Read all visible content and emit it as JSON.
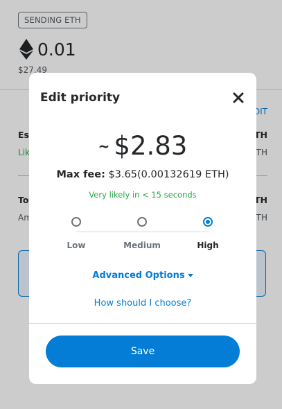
{
  "background": {
    "badge": "SENDING ETH",
    "eth_amount": "0.01",
    "fiat_amount": "$27.49",
    "edit_link": "DIT",
    "rows": [
      {
        "label": "Es",
        "sub": "Lik",
        "right": "TH",
        "right_sub": "TH"
      },
      {
        "label": "To",
        "sub": "Am",
        "right": "TH",
        "right_sub": "TH"
      }
    ]
  },
  "modal": {
    "title": "Edit priority",
    "close_icon": "close-icon",
    "fee_tilde": "~",
    "fee_amount": "$2.83",
    "max_fee_label": "Max fee:",
    "max_fee_value": "$3.65",
    "max_fee_eth": "(0.00132619 ETH)",
    "likely_text": "Very likely in < 15 seconds",
    "options": [
      {
        "label": "Low",
        "selected": false
      },
      {
        "label": "Medium",
        "selected": false
      },
      {
        "label": "High",
        "selected": true
      }
    ],
    "advanced_label": "Advanced Options",
    "choose_label": "How should I choose?",
    "save_label": "Save"
  },
  "colors": {
    "accent": "#037dd6",
    "success": "#28a745",
    "text": "#24272a"
  }
}
